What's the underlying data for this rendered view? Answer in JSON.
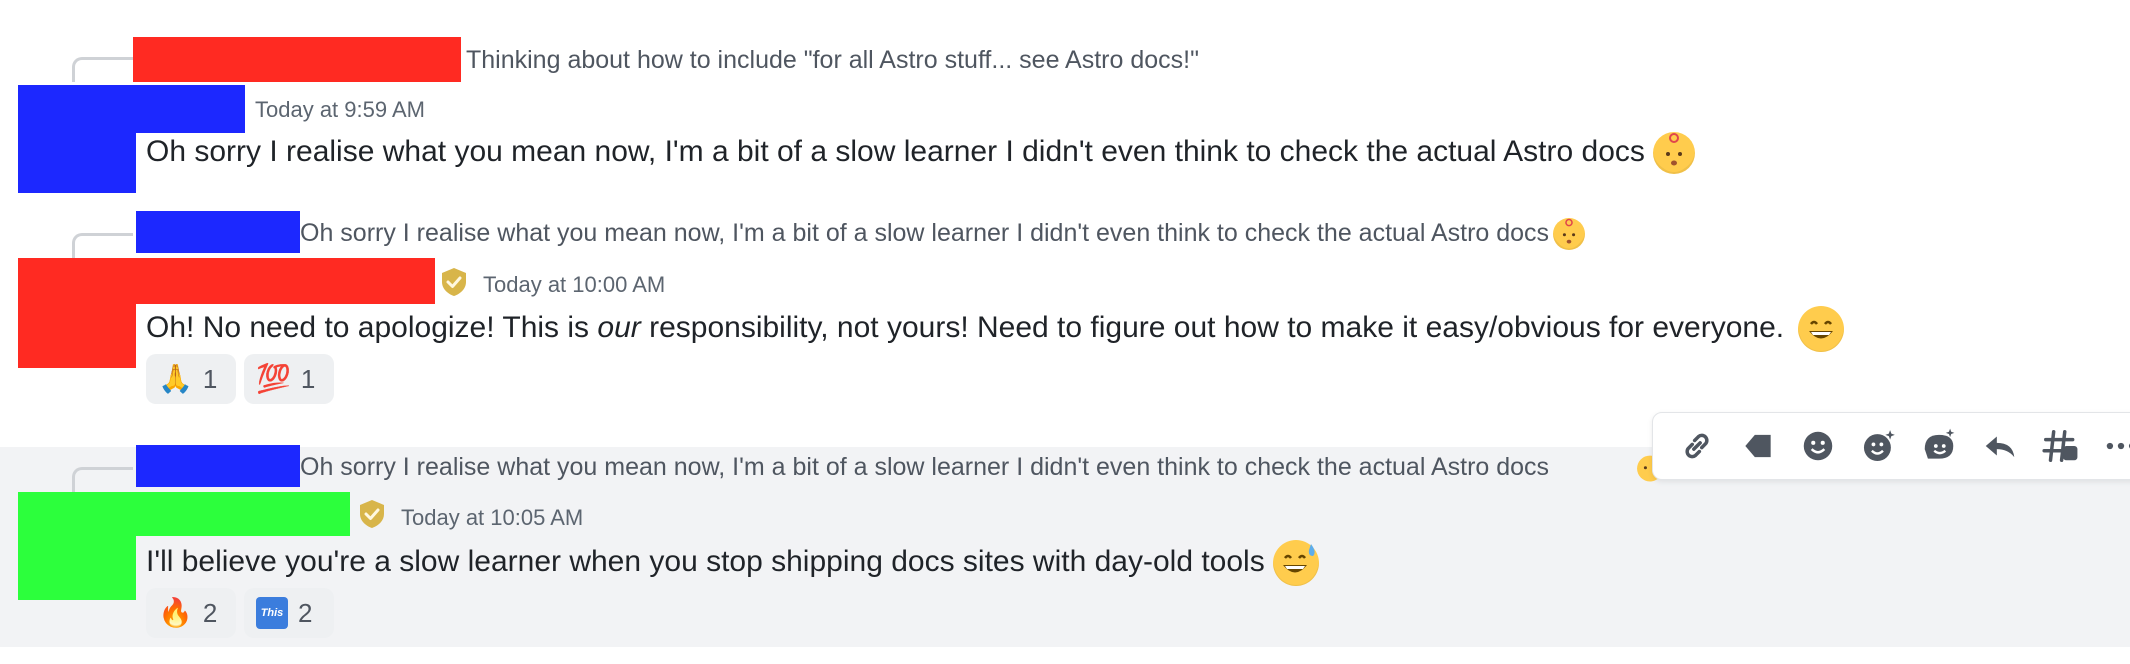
{
  "messages": [
    {
      "reply_preview": "Thinking about how to include \"for all Astro stuff... see Astro docs!\"",
      "timestamp": "Today at 9:59 AM",
      "text": "Oh sorry I realise what you mean now, I'm a bit of a slow learner I didn't even think to check the actual Astro docs"
    },
    {
      "reply_preview": "Oh sorry I realise what you mean now, I'm a bit of a slow learner I didn't even think to check the actual Astro docs",
      "timestamp": "Today at 10:00 AM",
      "text_before": "Oh! No need to apologize! This is ",
      "text_em": "our",
      "text_after": " responsibility, not yours!  Need to figure out how to make it easy/obvious for everyone.",
      "reactions": [
        {
          "emoji": "🙏",
          "count": "1"
        },
        {
          "emoji": "💯",
          "count": "1"
        }
      ]
    },
    {
      "reply_preview": "Oh sorry I realise what you mean now, I'm a bit of a slow learner I didn't even think to check the actual Astro docs",
      "timestamp": "Today at 10:05 AM",
      "text": "I'll believe you're a slow learner when you stop shipping docs sites with day-old tools",
      "reactions": [
        {
          "emoji": "🔥",
          "count": "2"
        },
        {
          "emoji": "This",
          "count": "2"
        }
      ]
    }
  ],
  "toolbar": {
    "icons": [
      "link-icon",
      "flag-icon",
      "reaction-icon",
      "super-reaction-icon",
      "super-reaction-alt-icon",
      "reply-icon",
      "thread-icon",
      "more-icon"
    ]
  },
  "colors": {
    "redact_red": "#ff2a22",
    "redact_blue": "#1c28ff",
    "redact_green": "#2cff3c",
    "shield_gold": "#d8b54a",
    "hover_bg": "#f2f3f5"
  }
}
